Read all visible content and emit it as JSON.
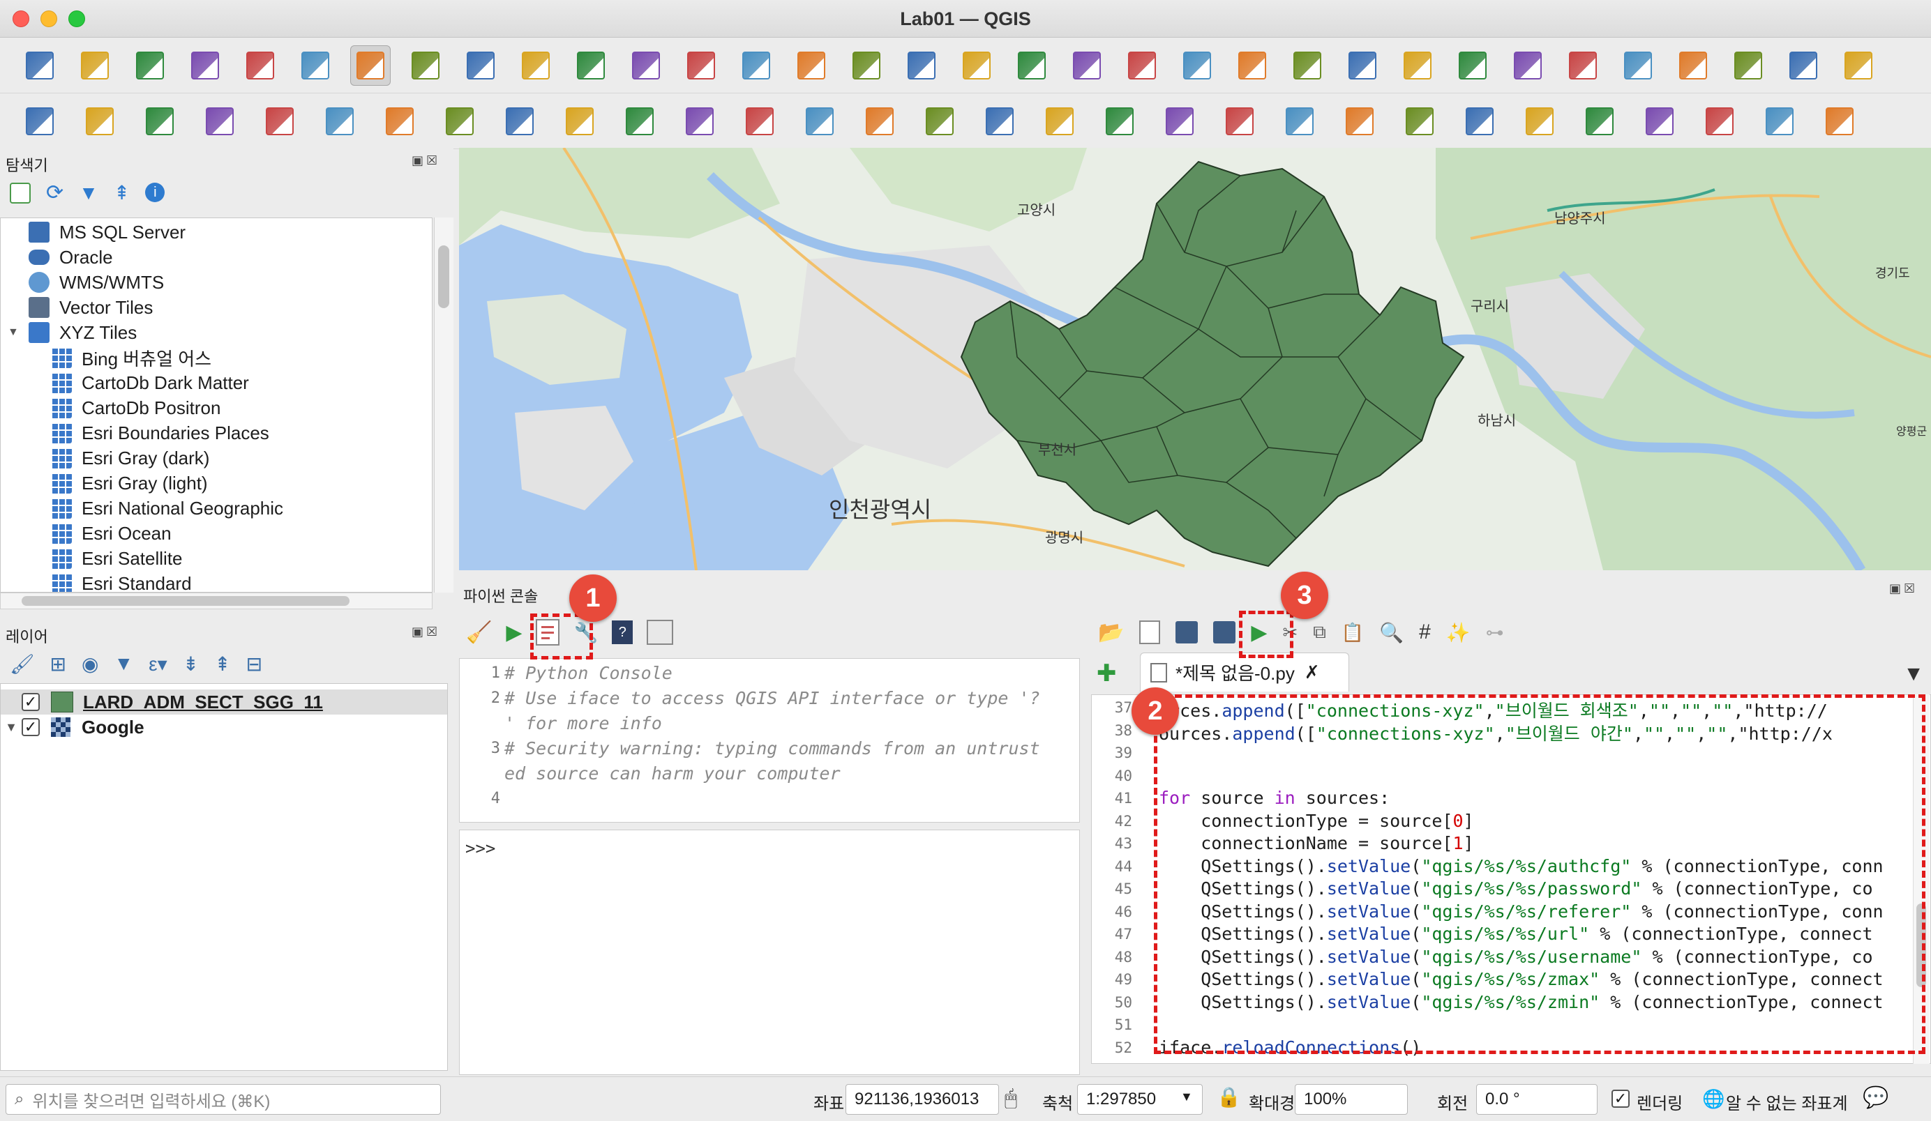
{
  "window": {
    "title": "Lab01 — QGIS"
  },
  "toolbar1_icons": [
    "new-project-icon",
    "open-project-icon",
    "save-project-icon",
    "save-as-icon",
    "print-layout-icon",
    "style-manager-icon",
    "pan-icon",
    "pan-to-selection-icon",
    "zoom-in-icon",
    "zoom-out-icon",
    "zoom-full-icon",
    "zoom-to-selection-icon",
    "zoom-to-layer-icon",
    "zoom-native-icon",
    "zoom-last-icon",
    "zoom-next-icon",
    "new-map-view-icon",
    "new-3d-view-icon",
    "bookmark-new-icon",
    "bookmarks-icon",
    "temporal-controller-icon",
    "refresh-icon",
    "select-features-icon",
    "attribute-table-icon",
    "deselect-icon",
    "annotation-icon",
    "identify-icon",
    "field-calculator-icon",
    "processing-toolbox-icon",
    "statistics-sum-icon",
    "open-attribute-table-icon",
    "measure-icon",
    "map-tips-icon",
    "plugins-gear-icon"
  ],
  "toolbar2_icons": [
    "data-source-manager-icon",
    "new-geopackage-icon",
    "new-shapefile-icon",
    "new-temp-layer-icon",
    "new-virtual-layer-icon",
    "add-raster-icon",
    "add-mesh-icon",
    "digitize-icon",
    "edit-pencil-icon",
    "save-edits-icon",
    "add-feature-icon",
    "move-feature-icon",
    "vertex-tool-icon",
    "modify-attributes-icon",
    "delete-selected-icon",
    "cut-icon",
    "copy-icon",
    "paste-icon",
    "undo-icon",
    "redo-icon",
    "label-abc-icon",
    "diagram-icon",
    "label-pin-icon",
    "label-show-icon",
    "label-move-icon",
    "label-rotate-icon",
    "label-change-icon",
    "osm-icon",
    "python-icon",
    "svg-icon",
    "help-icon"
  ],
  "browser": {
    "title": "탐색기",
    "items": [
      {
        "label": "MS SQL Server",
        "icon": "mssql-icon",
        "indent": 0
      },
      {
        "label": "Oracle",
        "icon": "oracle-icon",
        "indent": 0
      },
      {
        "label": "WMS/WMTS",
        "icon": "wms-globe-icon",
        "indent": 0
      },
      {
        "label": "Vector Tiles",
        "icon": "vector-tiles-icon",
        "indent": 0
      },
      {
        "label": "XYZ Tiles",
        "icon": "xyz-tiles-icon",
        "indent": 0,
        "expanded": true
      },
      {
        "label": "Bing 버츄얼 어스",
        "icon": "xyz-tile-icon",
        "indent": 1
      },
      {
        "label": "CartoDb Dark Matter",
        "icon": "xyz-tile-icon",
        "indent": 1
      },
      {
        "label": "CartoDb Positron",
        "icon": "xyz-tile-icon",
        "indent": 1
      },
      {
        "label": "Esri Boundaries Places",
        "icon": "xyz-tile-icon",
        "indent": 1
      },
      {
        "label": "Esri Gray (dark)",
        "icon": "xyz-tile-icon",
        "indent": 1
      },
      {
        "label": "Esri Gray (light)",
        "icon": "xyz-tile-icon",
        "indent": 1
      },
      {
        "label": "Esri National Geographic",
        "icon": "xyz-tile-icon",
        "indent": 1
      },
      {
        "label": "Esri Ocean",
        "icon": "xyz-tile-icon",
        "indent": 1
      },
      {
        "label": "Esri Satellite",
        "icon": "xyz-tile-icon",
        "indent": 1
      },
      {
        "label": "Esri Standard",
        "icon": "xyz-tile-icon",
        "indent": 1
      }
    ]
  },
  "layers": {
    "title": "레이어",
    "items": [
      {
        "label": "LARD_ADM_SECT_SGG_11",
        "checked": true,
        "color": "#5a8f5e"
      },
      {
        "label": "Google",
        "checked": true
      }
    ]
  },
  "map": {
    "labels": [
      "고양시",
      "남양주시",
      "구리시",
      "하남시",
      "부천시",
      "인천광역시",
      "광명시",
      "경기도",
      "양평군"
    ],
    "polygon_fill": "#5e8f5f",
    "water": "#a9c9f0",
    "land": "#e9eee6"
  },
  "console": {
    "title": "파이썬 콘솔",
    "intro_lines": [
      {
        "n": "1",
        "text": "# Python Console"
      },
      {
        "n": "2",
        "text": "# Use iface to access QGIS API interface or type '?"
      },
      {
        "n": "",
        "text": "' for more info"
      },
      {
        "n": "3",
        "text": "# Security warning: typing commands from an untrust"
      },
      {
        "n": "",
        "text": "ed source can harm your computer"
      },
      {
        "n": "4",
        "text": ""
      }
    ],
    "prompt": ">>>"
  },
  "script": {
    "tab_label": "*제목 없음-0.py",
    "lines": [
      {
        "n": "37",
        "text": "urces.append([\"connections-xyz\",\"브이월드 회색조\",\"\",\"\",\"\",\"http://"
      },
      {
        "n": "38",
        "text": "ources.append([\"connections-xyz\",\"브이월드 야간\",\"\",\"\",\"\",\"http://x"
      },
      {
        "n": "39",
        "text": ""
      },
      {
        "n": "40",
        "text": ""
      },
      {
        "n": "41",
        "text": "for source in sources:"
      },
      {
        "n": "42",
        "text": "    connectionType = source[0]"
      },
      {
        "n": "43",
        "text": "    connectionName = source[1]"
      },
      {
        "n": "44",
        "text": "    QSettings().setValue(\"qgis/%s/%s/authcfg\" % (connectionType, conn"
      },
      {
        "n": "45",
        "text": "    QSettings().setValue(\"qgis/%s/%s/password\" % (connectionType, co"
      },
      {
        "n": "46",
        "text": "    QSettings().setValue(\"qgis/%s/%s/referer\" % (connectionType, conn"
      },
      {
        "n": "47",
        "text": "    QSettings().setValue(\"qgis/%s/%s/url\" % (connectionType, connect"
      },
      {
        "n": "48",
        "text": "    QSettings().setValue(\"qgis/%s/%s/username\" % (connectionType, co"
      },
      {
        "n": "49",
        "text": "    QSettings().setValue(\"qgis/%s/%s/zmax\" % (connectionType, connect"
      },
      {
        "n": "50",
        "text": "    QSettings().setValue(\"qgis/%s/%s/zmin\" % (connectionType, connect"
      },
      {
        "n": "51",
        "text": ""
      },
      {
        "n": "52",
        "text": "iface.reloadConnections()"
      }
    ]
  },
  "callouts": [
    "1",
    "2",
    "3"
  ],
  "statusbar": {
    "search_placeholder": "위치를 찾으려면 입력하세요 (⌘K)",
    "coord_label": "좌표",
    "coord_value": "921136,1936013",
    "scale_label": "축척",
    "scale_value": "1:297850",
    "magnifier_label": "확대경",
    "magnifier_value": "100%",
    "rotation_label": "회전",
    "rotation_value": "0.0 °",
    "render_label": "렌더링",
    "crs_label": "알 수 없는 좌표계"
  }
}
